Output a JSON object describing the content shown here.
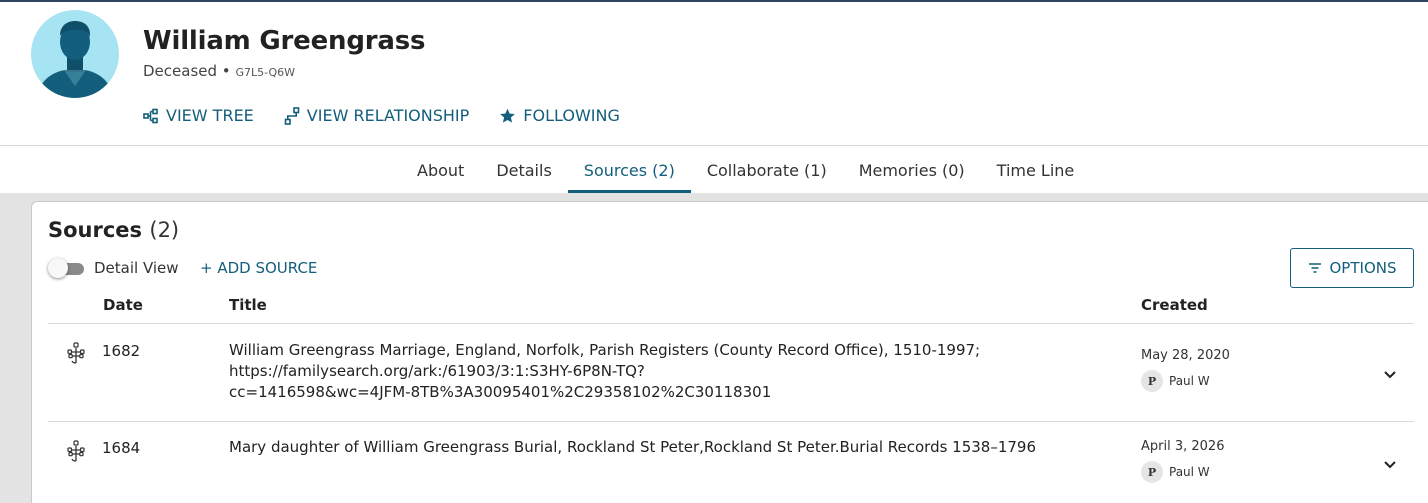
{
  "person": {
    "name": "William Greengrass",
    "status": "Deceased",
    "separator": "•",
    "pid": "G7L5-Q6W"
  },
  "actions": {
    "view_tree": "VIEW TREE",
    "view_relationship": "VIEW RELATIONSHIP",
    "following": "FOLLOWING"
  },
  "tabs": [
    {
      "label": "About"
    },
    {
      "label": "Details"
    },
    {
      "label": "Sources (2)"
    },
    {
      "label": "Collaborate (1)"
    },
    {
      "label": "Memories (0)"
    },
    {
      "label": "Time Line"
    }
  ],
  "active_tab": "Sources (2)",
  "sources": {
    "title": "Sources",
    "count": "(2)",
    "detail_view_label": "Detail View",
    "add_source_label": "+ ADD SOURCE",
    "options_label": "OPTIONS",
    "columns": {
      "date": "Date",
      "title": "Title",
      "created": "Created"
    },
    "rows": [
      {
        "icon": "family-tree-icon",
        "date": "1682",
        "title_line1": "William Greengrass Marriage, England, Norfolk, Parish Registers (County Record Office), 1510-1997;",
        "title_line2": "https://familysearch.org/ark:/61903/3:1:S3HY-6P8N-TQ?",
        "title_line3": "cc=1416598&wc=4JFM-8TB%3A30095401%2C29358102%2C30118301",
        "created_date": "May 28, 2020",
        "user_initial": "P",
        "user_name": "Paul W"
      },
      {
        "icon": "family-tree-icon",
        "date": "1684",
        "title_line1": "Mary daughter of William Greengrass Burial, Rockland St Peter,Rockland St Peter.Burial Records 1538–1796",
        "created_date": "April 3, 2026",
        "user_initial": "P",
        "user_name": "Paul W"
      }
    ]
  },
  "colors": {
    "accent": "#135e7c",
    "avatar_bg": "#a6e4f3",
    "avatar_figure": "#135e7c",
    "page_bg": "#e3e3e3"
  }
}
